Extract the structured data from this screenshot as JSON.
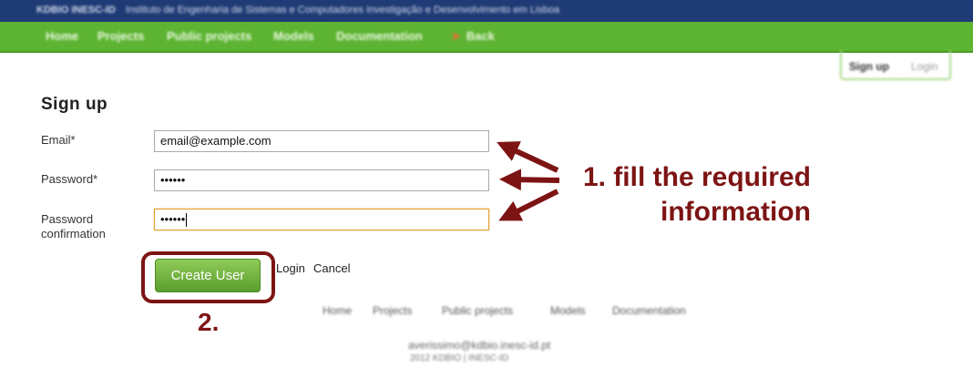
{
  "header": {
    "brand": "KDBIO INESC-ID",
    "institution": "Instituto de Engenharia de Sistemas e Computadores Investigação e Desenvolvimento em Lisboa"
  },
  "nav": {
    "home": "Home",
    "projects": "Projects",
    "public_projects": "Public projects",
    "models": "Models",
    "documentation": "Documentation",
    "back": "Back",
    "back_icon": "arrow-right-icon"
  },
  "auth": {
    "signup": "Sign up",
    "login": "Login"
  },
  "form": {
    "title": "Sign up",
    "email_label": "Email*",
    "email_value": "email@example.com",
    "password_label": "Password*",
    "password_value": "••••••",
    "confirm_label_line1": "Password",
    "confirm_label_line2": "confirmation",
    "confirm_value": "••••••",
    "submit": "Create User",
    "login_link": "Login",
    "cancel_link": "Cancel"
  },
  "annotations": {
    "step1_line1": "1. fill the required",
    "step1_line2": "information",
    "step2": "2.",
    "color": "#7d1414"
  },
  "footer": {
    "home": "Home",
    "projects": "Projects",
    "public_projects": "Public projects",
    "models": "Models",
    "documentation": "Documentation",
    "email": "averissimo@kdbio.inesc-id.pt",
    "copyright": "2012 KDBIO | INESC-ID"
  },
  "colors": {
    "topbar": "#1f3b75",
    "navbar": "#5db432",
    "button": "#6fb23d"
  }
}
